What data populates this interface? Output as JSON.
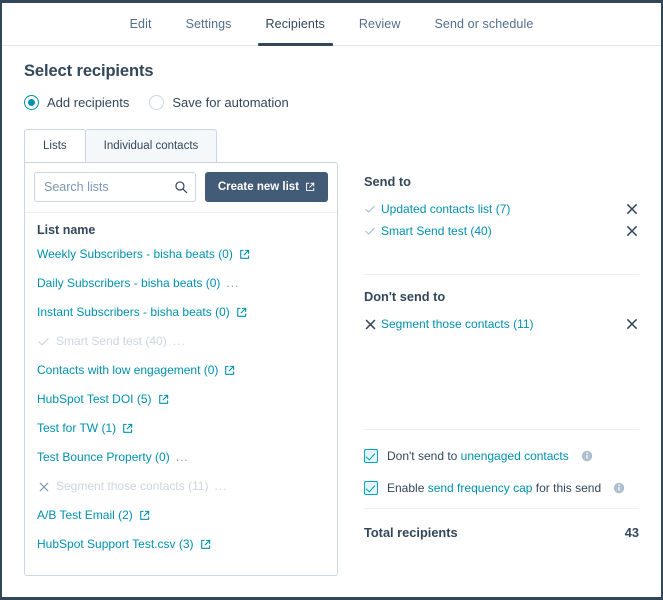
{
  "topnav": {
    "tabs": [
      {
        "label": "Edit",
        "active": false
      },
      {
        "label": "Settings",
        "active": false
      },
      {
        "label": "Recipients",
        "active": true
      },
      {
        "label": "Review",
        "active": false
      },
      {
        "label": "Send or schedule",
        "active": false
      }
    ]
  },
  "page": {
    "title": "Select recipients"
  },
  "mode": {
    "options": [
      {
        "label": "Add recipients",
        "selected": true
      },
      {
        "label": "Save for automation",
        "selected": false
      }
    ]
  },
  "subtabs": [
    {
      "label": "Lists",
      "active": true
    },
    {
      "label": "Individual contacts",
      "active": false
    }
  ],
  "search": {
    "placeholder": "Search lists",
    "value": "",
    "icon": "search-icon"
  },
  "create_list_button": {
    "label": "Create new list",
    "icon": "external-link-icon"
  },
  "lists": {
    "column_header": "List name",
    "items": [
      {
        "name": "Weekly Subscribers - bisha beats (0)",
        "state": "default",
        "trailing": "external-link-icon",
        "leading": "none"
      },
      {
        "name": "Daily Subscribers - bisha beats (0)",
        "state": "default",
        "trailing": "ellipsis",
        "leading": "none"
      },
      {
        "name": "Instant Subscribers - bisha beats (0)",
        "state": "default",
        "trailing": "external-link-icon",
        "leading": "none"
      },
      {
        "name": "Smart Send test (40)",
        "state": "selected-send",
        "trailing": "ellipsis",
        "leading": "check-icon"
      },
      {
        "name": "Contacts with low engagement (0)",
        "state": "default",
        "trailing": "external-link-icon",
        "leading": "none"
      },
      {
        "name": "HubSpot Test DOI (5)",
        "state": "default",
        "trailing": "external-link-icon",
        "leading": "none"
      },
      {
        "name": "Test for TW (1)",
        "state": "default",
        "trailing": "external-link-icon",
        "leading": "none"
      },
      {
        "name": "Test Bounce Property (0)",
        "state": "default",
        "trailing": "ellipsis",
        "leading": "none"
      },
      {
        "name": "Segment those contacts (11)",
        "state": "selected-exclude",
        "trailing": "ellipsis",
        "leading": "x-icon"
      },
      {
        "name": "A/B Test Email (2)",
        "state": "default",
        "trailing": "external-link-icon",
        "leading": "none"
      },
      {
        "name": "HubSpot Support Test.csv (3)",
        "state": "default",
        "trailing": "external-link-icon",
        "leading": "none"
      }
    ],
    "ellipsis": "..."
  },
  "send_to": {
    "title": "Send to",
    "items": [
      {
        "label": "Updated contacts list (7)",
        "icon": "check-icon",
        "remove": "close-icon"
      },
      {
        "label": "Smart Send test (40)",
        "icon": "check-icon",
        "remove": "close-icon"
      }
    ]
  },
  "dont_send_to": {
    "title": "Don't send to",
    "items": [
      {
        "label": "Segment those contacts (11)",
        "icon": "x-icon",
        "remove": "close-icon"
      }
    ]
  },
  "options": {
    "unengaged": {
      "prefix": "Don't send to ",
      "link": "unengaged contacts",
      "suffix": "",
      "checked": true,
      "info": "info-icon"
    },
    "frequency_cap": {
      "prefix": "Enable ",
      "link": "send frequency cap",
      "suffix": " for this send",
      "checked": true,
      "info": "info-icon"
    }
  },
  "total": {
    "label": "Total recipients",
    "value": "43"
  },
  "colors": {
    "brand_dark": "#33475b",
    "link": "#0091ae",
    "button": "#425b76",
    "checkbox": "#00a4bd",
    "border": "#cbd6e2",
    "muted": "#cbd6e2"
  }
}
